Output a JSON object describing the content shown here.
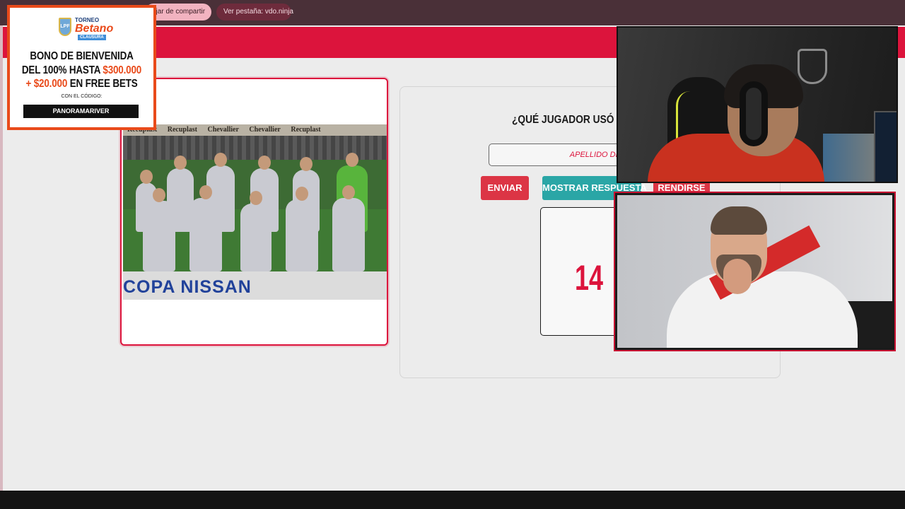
{
  "share_bar": {
    "stop_sharing_label": "ejar de compartir",
    "view_tab_label": "Ver pestaña: vdo.ninja"
  },
  "photo_card": {
    "sponsor_banners": [
      "Recuplast",
      "Recuplast",
      "Chevallier",
      "Chevallier",
      "Recuplast"
    ],
    "caption": "COPA NISSAN"
  },
  "game": {
    "question": "¿QUÉ JUGADOR USÓ EL D",
    "answer_placeholder": "APELLIDO DEL JUGAD",
    "send_label": "ENVIAR",
    "show_answer_label": "MOSTRAR RESPUESTA",
    "give_up_label": "RENDIRSE",
    "shirt_number": "14"
  },
  "ad": {
    "torneo": "TORNEO",
    "brand": "Betano",
    "tournament_stage": "CLAUSURA",
    "logo_text": "LPF",
    "line1": "BONO DE BIENVENIDA",
    "line2_a": "DEL 100% HASTA ",
    "line2_b": "$300.000",
    "line3_a": "+ $20.000",
    "line3_b": " EN FREE BETS",
    "code_label": "CON EL CÓDIGO:",
    "code": "PANORAMARIVER"
  },
  "colors": {
    "brand_red": "#dc143c",
    "teal_button": "#2aa6a6",
    "ad_orange": "#e94a1a",
    "share_bar": "#4a3038"
  }
}
